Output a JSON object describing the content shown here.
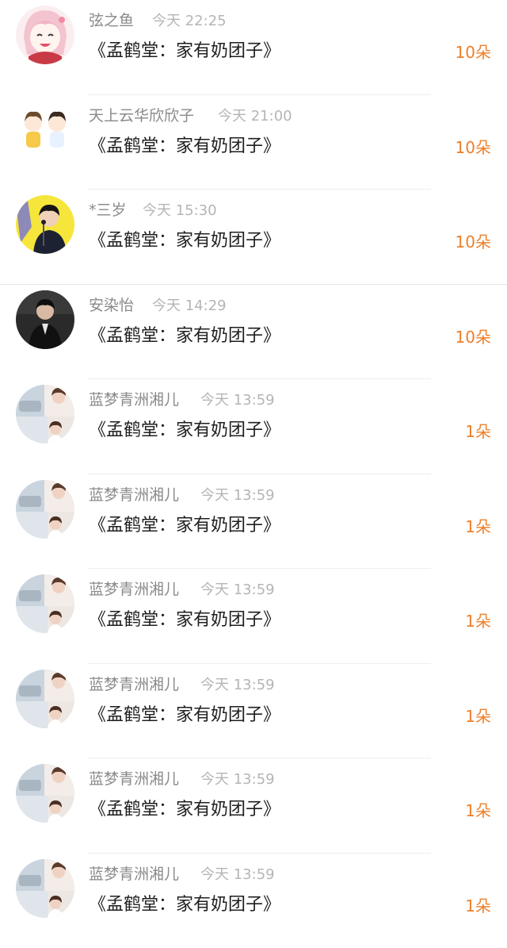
{
  "items": [
    {
      "user": "弦之鱼",
      "time": "今天 22:25",
      "gift": "《孟鹤堂：家有奶团子》",
      "count": "10朵",
      "avatar": "anime-girl-avatar"
    },
    {
      "user": "天上云华欣欣子",
      "time": "今天 21:00",
      "gift": "《孟鹤堂：家有奶团子》",
      "count": "10朵",
      "avatar": "cartoon-pair-avatar"
    },
    {
      "user": "*三岁",
      "time": "今天 15:30",
      "gift": "《孟鹤堂：家有奶团子》",
      "count": "10朵",
      "avatar": "yellow-performer-avatar"
    },
    {
      "user": "安染怡",
      "time": "今天 14:29",
      "gift": "《孟鹤堂：家有奶团子》",
      "count": "10朵",
      "avatar": "dark-portrait-avatar"
    },
    {
      "user": "蓝梦青洲湘儿",
      "time": "今天 13:59",
      "gift": "《孟鹤堂：家有奶团子》",
      "count": "1朵",
      "avatar": "collage-avatar"
    },
    {
      "user": "蓝梦青洲湘儿",
      "time": "今天 13:59",
      "gift": "《孟鹤堂：家有奶团子》",
      "count": "1朵",
      "avatar": "collage-avatar"
    },
    {
      "user": "蓝梦青洲湘儿",
      "time": "今天 13:59",
      "gift": "《孟鹤堂：家有奶团子》",
      "count": "1朵",
      "avatar": "collage-avatar"
    },
    {
      "user": "蓝梦青洲湘儿",
      "time": "今天 13:59",
      "gift": "《孟鹤堂：家有奶团子》",
      "count": "1朵",
      "avatar": "collage-avatar"
    },
    {
      "user": "蓝梦青洲湘儿",
      "time": "今天 13:59",
      "gift": "《孟鹤堂：家有奶团子》",
      "count": "1朵",
      "avatar": "collage-avatar"
    },
    {
      "user": "蓝梦青洲湘儿",
      "time": "今天 13:59",
      "gift": "《孟鹤堂：家有奶团子》",
      "count": "1朵",
      "avatar": "collage-avatar"
    }
  ],
  "colors": {
    "count": "#ee7f2a",
    "username": "#8a8a8a",
    "time": "#b5b5b5",
    "gift_text": "#1f1f1f",
    "divider": "#eeeeee"
  }
}
